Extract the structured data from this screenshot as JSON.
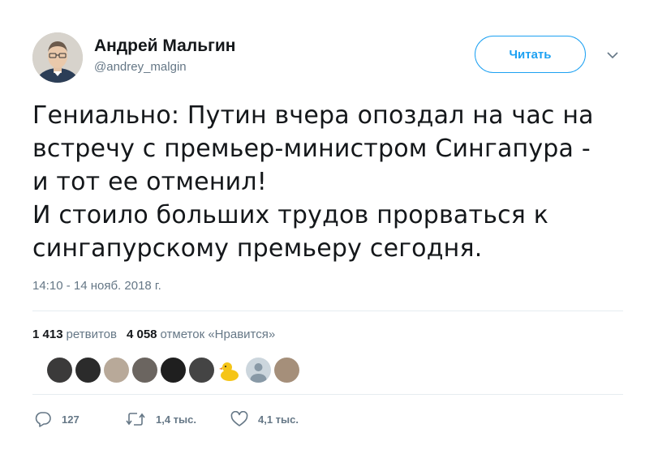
{
  "author": {
    "name": "Андрей Мальгин",
    "handle": "@andrey_malgin"
  },
  "follow_button": {
    "label": "Читать"
  },
  "tweet": {
    "text": "Гениально: Путин вчера опоздал на час на\nвстречу с премьер-министром Сингапура -\nи тот ее отменил!\nИ стоило больших трудов прорваться к\nсингапурскому премьеру сегодня.",
    "timestamp": "14:10 - 14 нояб. 2018 г."
  },
  "stats": {
    "retweets_count": "1 413",
    "retweets_label": "ретвитов",
    "likes_count": "4 058",
    "likes_label": "отметок «Нравится»"
  },
  "likers": [
    {
      "color": "#3b3a3a"
    },
    {
      "color": "#2b2b2b"
    },
    {
      "color": "#b8a999"
    },
    {
      "color": "#6b6560"
    },
    {
      "color": "#1f1f1f"
    },
    {
      "color": "#444444"
    },
    {
      "color": "#f5c518"
    },
    {
      "color": "#ccd6dd"
    },
    {
      "color": "#a58f7a"
    }
  ],
  "actions": {
    "reply_count": "127",
    "retweet_count": "1,4 тыс.",
    "like_count": "4,1 тыс."
  },
  "colors": {
    "accent": "#1da1f2",
    "secondary_text": "#657786",
    "divider": "#e6ecf0"
  }
}
